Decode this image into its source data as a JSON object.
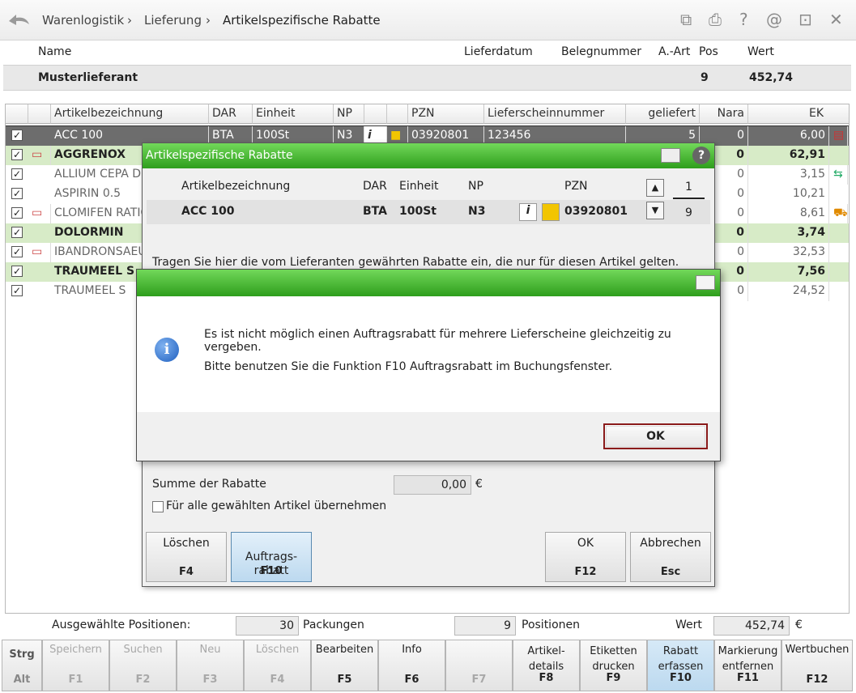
{
  "breadcrumb": {
    "items": [
      "Warenlogistik",
      "Lieferung",
      "Artikelspezifische Rabatte"
    ]
  },
  "header": {
    "cols": {
      "name": "Name",
      "lieferdatum": "Lieferdatum",
      "belegnummer": "Belegnummer",
      "aart": "A.-Art",
      "pos": "Pos",
      "wert": "Wert"
    },
    "supplier": "Musterlieferant",
    "pos_value": "9",
    "wert_value": "452,74"
  },
  "grid": {
    "headers": [
      "Artikelbezeichnung",
      "DAR",
      "Einheit",
      "NP",
      "PZN",
      "Lieferscheinnummer",
      "geliefert",
      "Nara",
      "EK"
    ],
    "first_row": {
      "name": "ACC 100",
      "dar": "BTA",
      "einheit": "100St",
      "np": "N3",
      "pzn": "03920801",
      "lsn": "123456",
      "geliefert": "5",
      "nara": "0",
      "ek": "6,00"
    },
    "rows": [
      {
        "name": "AGGRENOX",
        "nara": "0",
        "ek": "62,91",
        "bold": true,
        "green": true,
        "card": true
      },
      {
        "name": "ALLIUM CEPA D6",
        "nara": "0",
        "ek": "3,15",
        "bold": false,
        "green": false,
        "card": false
      },
      {
        "name": "ASPIRIN 0.5",
        "nara": "0",
        "ek": "10,21",
        "bold": false,
        "green": false,
        "card": false
      },
      {
        "name": "CLOMIFEN RATIOPHARM",
        "nara": "0",
        "ek": "8,61",
        "bold": false,
        "green": false,
        "card": true
      },
      {
        "name": "DOLORMIN",
        "nara": "0",
        "ek": "3,74",
        "bold": true,
        "green": true,
        "card": false
      },
      {
        "name": "IBANDRONSAEURE",
        "nara": "0",
        "ek": "32,53",
        "bold": false,
        "green": false,
        "card": true
      },
      {
        "name": "TRAUMEEL S",
        "nara": "0",
        "ek": "7,56",
        "bold": true,
        "green": true,
        "card": false
      },
      {
        "name": "TRAUMEEL S",
        "nara": "0",
        "ek": "24,52",
        "bold": false,
        "green": false,
        "card": false
      }
    ]
  },
  "summary": {
    "ausgewaehlt": "Ausgewählte Positionen:",
    "packungen_val": "30",
    "packungen": "Packungen",
    "positionen_val": "9",
    "positionen": "Positionen",
    "wert": "Wert",
    "wert_val": "452,74",
    "currency": "€"
  },
  "fkeys": [
    {
      "label": "Speichern",
      "key": "F1",
      "disabled": true
    },
    {
      "label": "Suchen",
      "key": "F2",
      "disabled": true
    },
    {
      "label": "Neu",
      "key": "F3",
      "disabled": true
    },
    {
      "label": "Löschen",
      "key": "F4",
      "disabled": true
    },
    {
      "label": "Bearbeiten",
      "key": "F5",
      "disabled": false
    },
    {
      "label": "Info",
      "key": "F6",
      "disabled": false
    },
    {
      "label": "",
      "key": "F7",
      "disabled": true
    },
    {
      "label": "Artikel-\ndetails",
      "key": "F8",
      "disabled": false
    },
    {
      "label": "Etiketten\ndrucken",
      "key": "F9",
      "disabled": false
    },
    {
      "label": "Rabatt\nerfassen",
      "key": "F10",
      "disabled": false
    },
    {
      "label": "Markierung\nentfernen",
      "key": "F11",
      "disabled": false
    },
    {
      "label": "Wertbuchen",
      "key": "F12",
      "disabled": false
    }
  ],
  "strg": "Strg",
  "alt": "Alt",
  "dialog1": {
    "title": "Artikelspezifische Rabatte",
    "cols": {
      "name": "Artikelbezeichnung",
      "dar": "DAR",
      "einheit": "Einheit",
      "np": "NP",
      "pzn": "PZN"
    },
    "article": {
      "name": "ACC 100",
      "dar": "BTA",
      "einheit": "100St",
      "np": "N3",
      "pzn": "03920801"
    },
    "counter_top": "1",
    "counter_bottom": "9",
    "hint": "Tragen Sie hier die vom Lieferanten gewährten Rabatte ein, die nur für diesen Artikel gelten.",
    "summe_label": "Summe der Rabatte",
    "summe_value": "0,00",
    "currency": "€",
    "alle_label": "Für alle gewählten Artikel übernehmen",
    "btn_loeschen": "Löschen",
    "btn_loeschen_key": "F4",
    "btn_auftrag": "Auftrags-\nrabatt",
    "btn_auftrag_key": "F10",
    "btn_ok": "OK",
    "btn_ok_key": "F12",
    "btn_abbrechen": "Abbrechen",
    "btn_abbrechen_key": "Esc"
  },
  "dialog2": {
    "line1": "Es ist nicht möglich einen Auftragsrabatt für mehrere Lieferscheine gleichzeitig zu vergeben.",
    "line2": "Bitte benutzen Sie die Funktion F10 Auftragsrabatt im Buchungsfenster.",
    "ok": "OK"
  },
  "colors": {
    "accent_green": "#3aa52a",
    "row_green": "#d7ebc7"
  }
}
